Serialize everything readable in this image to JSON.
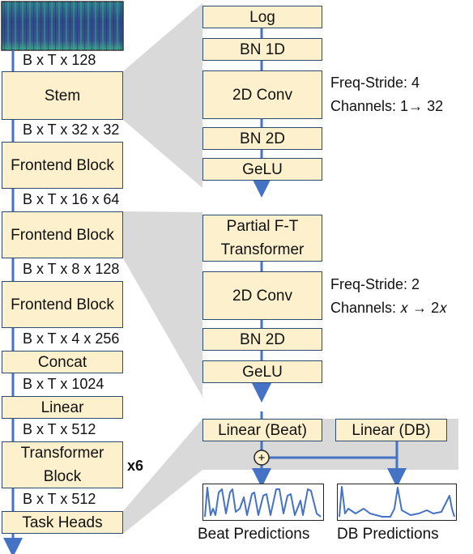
{
  "left_column": {
    "blocks": [
      "Stem",
      "Frontend Block",
      "Frontend Block",
      "Frontend Block",
      "Concat",
      "Linear",
      "Transformer Block",
      "Task Heads"
    ],
    "shapes": [
      "B x T x 128",
      "B x T x 32 x 32",
      "B x T x 16 x 64",
      "B x T x 8 x 128",
      "B x T x 4 x 256",
      "B x T x 1024",
      "B x T x 512",
      "B x T x 512"
    ],
    "repeat": "x6"
  },
  "stem_detail": {
    "blocks": [
      "Log",
      "BN 1D",
      "2D Conv",
      "BN 2D",
      "GeLU"
    ],
    "freq_stride": "Freq-Stride: 4",
    "channels": "Channels: 1→ 32"
  },
  "frontend_detail": {
    "blocks": [
      "Partial F-T Transformer",
      "2D Conv",
      "BN 2D",
      "GeLU"
    ],
    "freq_stride": "Freq-Stride: 2",
    "channels": "Channels: 𝑥 → 2𝑥"
  },
  "heads": {
    "beat": "Linear (Beat)",
    "db": "Linear (DB)",
    "sum_symbol": "+",
    "beat_label": "Beat Predictions",
    "db_label": "DB Predictions"
  },
  "colors": {
    "block_fill": "#fdf0cd",
    "block_border": "#2f4a70",
    "arrow": "#4472c4",
    "fan": "#d9d9d9"
  }
}
